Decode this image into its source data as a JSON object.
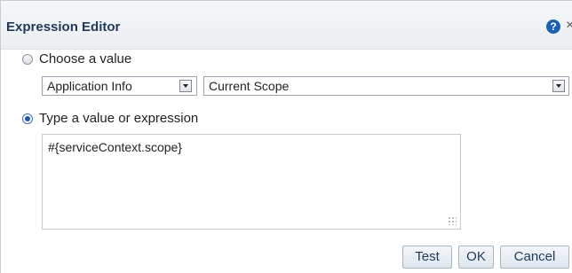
{
  "dialog": {
    "title": "Expression Editor",
    "help_icon": "help-icon",
    "help_glyph": "?",
    "close_icon": "close-icon",
    "close_glyph": "×"
  },
  "choose": {
    "label": "Choose a value",
    "checked": false,
    "category_value": "Application Info",
    "scope_value": "Current Scope"
  },
  "expression": {
    "label": "Type a value or expression",
    "checked": true,
    "value": "#{serviceContext.scope}"
  },
  "buttons": {
    "test": "Test",
    "ok": "OK",
    "cancel": "Cancel"
  },
  "colors": {
    "title": "#1f3a59",
    "help": "#1d5fb0",
    "radio_selected": "#1b56ad"
  }
}
